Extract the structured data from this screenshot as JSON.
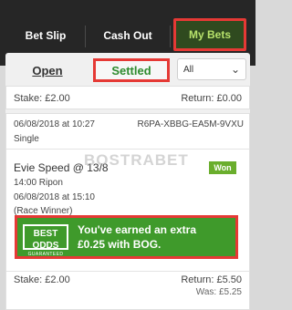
{
  "top_tabs": {
    "bet_slip": "Bet Slip",
    "cash_out": "Cash Out",
    "my_bets": "My Bets"
  },
  "sub_tabs": {
    "open": "Open",
    "settled": "Settled",
    "filter_value": "All"
  },
  "first_bet": {
    "stake": "Stake: £2.00",
    "return": "Return: £0.00"
  },
  "second_bet": {
    "datetime": "06/08/2018 at 10:27",
    "ref": "R6PA-XBBG-EA5M-9VXU",
    "type": "Single",
    "selection": "Evie Speed @ 13/8",
    "status": "Won",
    "race": "14:00 Ripon",
    "race_datetime": "06/08/2018 at 15:10",
    "market": "(Race Winner)",
    "stake": "Stake: £2.00",
    "return": "Return: £5.50",
    "was": "Was: £5.25"
  },
  "bog_banner": {
    "badge_line1": "BEST ODDS",
    "badge_line2": "GUARANTEED",
    "message_line1": "You've earned an extra",
    "message_line2": "£0.25 with BOG."
  },
  "watermark": "BOSTRABET",
  "colors": {
    "accent_green": "#3f9a2b",
    "highlight_red": "#e53935",
    "won_badge": "#6aae2d"
  }
}
